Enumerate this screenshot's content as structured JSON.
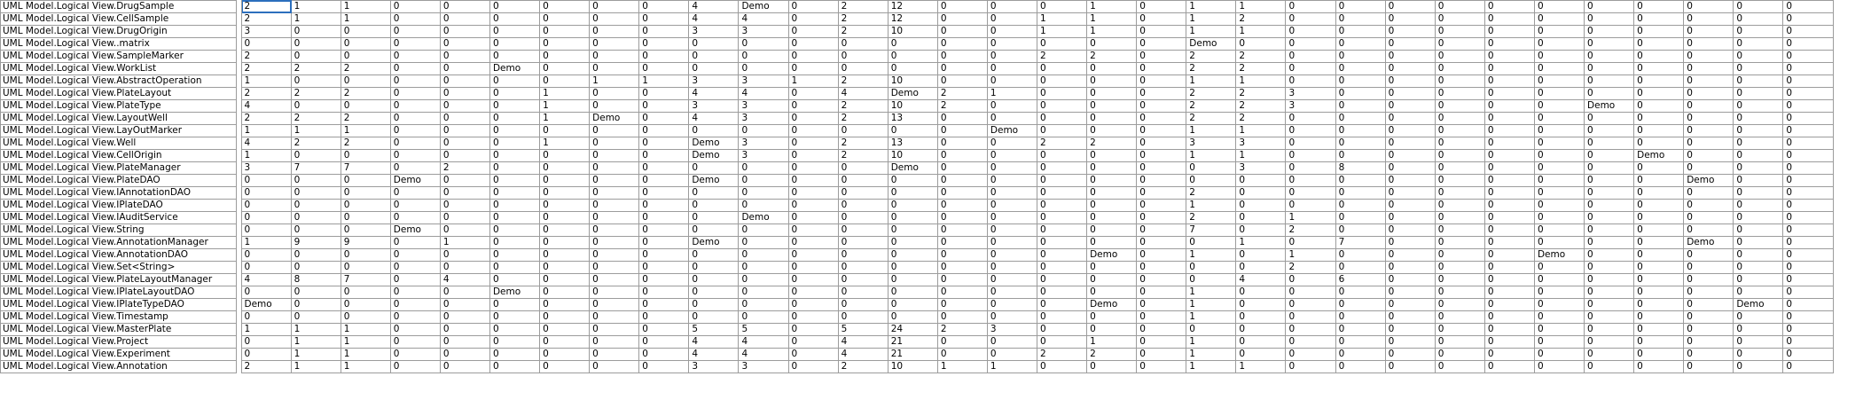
{
  "selection": {
    "row": 0,
    "accent": "#2c6fbd"
  },
  "rows": [
    {
      "name": "UML Model.Logical View.DrugSample",
      "values": [
        "2",
        "1",
        "1",
        "0",
        "0",
        "0",
        "0",
        "0",
        "0",
        "4",
        "Demo",
        "0",
        "2",
        "12",
        "0",
        "0",
        "0",
        "1",
        "0",
        "1",
        "1",
        "0",
        "0",
        "0",
        "0",
        "0",
        "0",
        "0",
        "0",
        "0",
        "0",
        "0"
      ]
    },
    {
      "name": "UML Model.Logical View.CellSample",
      "values": [
        "2",
        "1",
        "1",
        "0",
        "0",
        "0",
        "0",
        "0",
        "0",
        "4",
        "4",
        "0",
        "2",
        "12",
        "0",
        "0",
        "1",
        "1",
        "0",
        "1",
        "2",
        "0",
        "0",
        "0",
        "0",
        "0",
        "0",
        "0",
        "0",
        "0",
        "0",
        "0"
      ]
    },
    {
      "name": "UML Model.Logical View.DrugOrigin",
      "values": [
        "3",
        "0",
        "0",
        "0",
        "0",
        "0",
        "0",
        "0",
        "0",
        "3",
        "3",
        "0",
        "2",
        "10",
        "0",
        "0",
        "1",
        "1",
        "0",
        "1",
        "1",
        "0",
        "0",
        "0",
        "0",
        "0",
        "0",
        "0",
        "0",
        "0",
        "0",
        "0"
      ]
    },
    {
      "name": "UML Model.Logical View..matrix",
      "values": [
        "0",
        "0",
        "0",
        "0",
        "0",
        "0",
        "0",
        "0",
        "0",
        "0",
        "0",
        "0",
        "0",
        "0",
        "0",
        "0",
        "0",
        "0",
        "0",
        "Demo",
        "0",
        "0",
        "0",
        "0",
        "0",
        "0",
        "0",
        "0",
        "0",
        "0",
        "0",
        "0"
      ]
    },
    {
      "name": "UML Model.Logical View.SampleMarker",
      "values": [
        "2",
        "0",
        "0",
        "0",
        "0",
        "0",
        "0",
        "0",
        "0",
        "0",
        "0",
        "0",
        "0",
        "0",
        "0",
        "0",
        "2",
        "2",
        "0",
        "2",
        "2",
        "0",
        "0",
        "0",
        "0",
        "0",
        "0",
        "0",
        "0",
        "0",
        "0",
        "0"
      ]
    },
    {
      "name": "UML Model.Logical View.WorkList",
      "values": [
        "2",
        "2",
        "2",
        "0",
        "0",
        "Demo",
        "0",
        "0",
        "0",
        "0",
        "0",
        "0",
        "0",
        "0",
        "0",
        "0",
        "0",
        "0",
        "0",
        "2",
        "2",
        "0",
        "0",
        "0",
        "0",
        "0",
        "0",
        "0",
        "0",
        "0",
        "0",
        "0"
      ]
    },
    {
      "name": "UML Model.Logical View.AbstractOperation",
      "values": [
        "1",
        "0",
        "0",
        "0",
        "0",
        "0",
        "0",
        "1",
        "1",
        "3",
        "3",
        "1",
        "2",
        "10",
        "0",
        "0",
        "0",
        "0",
        "0",
        "1",
        "1",
        "0",
        "0",
        "0",
        "0",
        "0",
        "0",
        "0",
        "0",
        "0",
        "0",
        "0"
      ]
    },
    {
      "name": "UML Model.Logical View.PlateLayout",
      "values": [
        "2",
        "2",
        "2",
        "0",
        "0",
        "0",
        "1",
        "0",
        "0",
        "4",
        "4",
        "0",
        "4",
        "Demo",
        "2",
        "1",
        "0",
        "0",
        "0",
        "2",
        "2",
        "3",
        "0",
        "0",
        "0",
        "0",
        "0",
        "0",
        "0",
        "0",
        "0",
        "0"
      ]
    },
    {
      "name": "UML Model.Logical View.PlateType",
      "values": [
        "4",
        "0",
        "0",
        "0",
        "0",
        "0",
        "1",
        "0",
        "0",
        "3",
        "3",
        "0",
        "2",
        "10",
        "2",
        "0",
        "0",
        "0",
        "0",
        "2",
        "2",
        "3",
        "0",
        "0",
        "0",
        "0",
        "0",
        "Demo",
        "0",
        "0",
        "0",
        "0"
      ]
    },
    {
      "name": "UML Model.Logical View.LayoutWell",
      "values": [
        "2",
        "2",
        "2",
        "0",
        "0",
        "0",
        "1",
        "Demo",
        "0",
        "4",
        "3",
        "0",
        "2",
        "13",
        "0",
        "0",
        "0",
        "0",
        "0",
        "2",
        "2",
        "0",
        "0",
        "0",
        "0",
        "0",
        "0",
        "0",
        "0",
        "0",
        "0",
        "0"
      ]
    },
    {
      "name": "UML Model.Logical View.LayOutMarker",
      "values": [
        "1",
        "1",
        "1",
        "0",
        "0",
        "0",
        "0",
        "0",
        "0",
        "0",
        "0",
        "0",
        "0",
        "0",
        "0",
        "Demo",
        "0",
        "0",
        "0",
        "1",
        "1",
        "0",
        "0",
        "0",
        "0",
        "0",
        "0",
        "0",
        "0",
        "0",
        "0",
        "0"
      ]
    },
    {
      "name": "UML Model.Logical View.Well",
      "values": [
        "4",
        "2",
        "2",
        "0",
        "0",
        "0",
        "1",
        "0",
        "0",
        "Demo",
        "3",
        "0",
        "2",
        "13",
        "0",
        "0",
        "2",
        "2",
        "0",
        "3",
        "3",
        "0",
        "0",
        "0",
        "0",
        "0",
        "0",
        "0",
        "0",
        "0",
        "0",
        "0"
      ]
    },
    {
      "name": "UML Model.Logical View.CellOrigin",
      "values": [
        "1",
        "0",
        "0",
        "0",
        "0",
        "0",
        "0",
        "0",
        "0",
        "Demo",
        "3",
        "0",
        "2",
        "10",
        "0",
        "0",
        "0",
        "0",
        "0",
        "1",
        "1",
        "0",
        "0",
        "0",
        "0",
        "0",
        "0",
        "0",
        "Demo",
        "0",
        "0",
        "0"
      ]
    },
    {
      "name": "UML Model.Logical View.PlateManager",
      "values": [
        "3",
        "7",
        "7",
        "0",
        "2",
        "0",
        "0",
        "0",
        "0",
        "0",
        "0",
        "0",
        "0",
        "Demo",
        "0",
        "0",
        "0",
        "0",
        "0",
        "0",
        "3",
        "0",
        "8",
        "0",
        "0",
        "0",
        "0",
        "0",
        "0",
        "0",
        "0",
        "0"
      ]
    },
    {
      "name": "UML Model.Logical View.PlateDAO",
      "values": [
        "0",
        "0",
        "0",
        "Demo",
        "0",
        "0",
        "0",
        "0",
        "0",
        "Demo",
        "0",
        "0",
        "0",
        "0",
        "0",
        "0",
        "0",
        "0",
        "0",
        "0",
        "0",
        "0",
        "0",
        "0",
        "0",
        "0",
        "0",
        "0",
        "0",
        "Demo",
        "0",
        "0"
      ]
    },
    {
      "name": "UML Model.Logical View.IAnnotationDAO",
      "values": [
        "0",
        "0",
        "0",
        "0",
        "0",
        "0",
        "0",
        "0",
        "0",
        "0",
        "0",
        "0",
        "0",
        "0",
        "0",
        "0",
        "0",
        "0",
        "0",
        "2",
        "0",
        "0",
        "0",
        "0",
        "0",
        "0",
        "0",
        "0",
        "0",
        "0",
        "0",
        "0"
      ]
    },
    {
      "name": "UML Model.Logical View.IPlateDAO",
      "values": [
        "0",
        "0",
        "0",
        "0",
        "0",
        "0",
        "0",
        "0",
        "0",
        "0",
        "0",
        "0",
        "0",
        "0",
        "0",
        "0",
        "0",
        "0",
        "0",
        "1",
        "0",
        "0",
        "0",
        "0",
        "0",
        "0",
        "0",
        "0",
        "0",
        "0",
        "0",
        "0"
      ]
    },
    {
      "name": "UML Model.Logical View.IAuditService",
      "values": [
        "0",
        "0",
        "0",
        "0",
        "0",
        "0",
        "0",
        "0",
        "0",
        "0",
        "Demo",
        "0",
        "0",
        "0",
        "0",
        "0",
        "0",
        "0",
        "0",
        "2",
        "0",
        "1",
        "0",
        "0",
        "0",
        "0",
        "0",
        "0",
        "0",
        "0",
        "0",
        "0"
      ]
    },
    {
      "name": "UML Model.Logical View.String",
      "values": [
        "0",
        "0",
        "0",
        "Demo",
        "0",
        "0",
        "0",
        "0",
        "0",
        "0",
        "0",
        "0",
        "0",
        "0",
        "0",
        "0",
        "0",
        "0",
        "0",
        "7",
        "0",
        "2",
        "0",
        "0",
        "0",
        "0",
        "0",
        "0",
        "0",
        "0",
        "0",
        "0"
      ]
    },
    {
      "name": "UML Model.Logical View.AnnotationManager",
      "values": [
        "1",
        "9",
        "9",
        "0",
        "1",
        "0",
        "0",
        "0",
        "0",
        "Demo",
        "0",
        "0",
        "0",
        "0",
        "0",
        "0",
        "0",
        "0",
        "0",
        "0",
        "1",
        "0",
        "7",
        "0",
        "0",
        "0",
        "0",
        "0",
        "0",
        "Demo",
        "0",
        "0"
      ]
    },
    {
      "name": "UML Model.Logical View.AnnotationDAO",
      "values": [
        "0",
        "0",
        "0",
        "0",
        "0",
        "0",
        "0",
        "0",
        "0",
        "0",
        "0",
        "0",
        "0",
        "0",
        "0",
        "0",
        "0",
        "Demo",
        "0",
        "1",
        "0",
        "1",
        "0",
        "0",
        "0",
        "0",
        "Demo",
        "0",
        "0",
        "0",
        "0",
        "0"
      ]
    },
    {
      "name": "UML Model.Logical View.Set<String>",
      "values": [
        "0",
        "0",
        "0",
        "0",
        "0",
        "0",
        "0",
        "0",
        "0",
        "0",
        "0",
        "0",
        "0",
        "0",
        "0",
        "0",
        "0",
        "0",
        "0",
        "0",
        "0",
        "2",
        "0",
        "0",
        "0",
        "0",
        "0",
        "0",
        "0",
        "0",
        "0",
        "0"
      ]
    },
    {
      "name": "UML Model.Logical View.PlateLayoutManager",
      "values": [
        "4",
        "8",
        "7",
        "0",
        "4",
        "0",
        "0",
        "0",
        "0",
        "0",
        "0",
        "0",
        "0",
        "0",
        "0",
        "0",
        "0",
        "0",
        "0",
        "0",
        "4",
        "0",
        "6",
        "0",
        "0",
        "0",
        "0",
        "0",
        "0",
        "0",
        "0",
        "0"
      ]
    },
    {
      "name": "UML Model.Logical View.IPlateLayoutDAO",
      "values": [
        "0",
        "0",
        "0",
        "0",
        "0",
        "Demo",
        "0",
        "0",
        "0",
        "0",
        "0",
        "0",
        "0",
        "0",
        "0",
        "0",
        "0",
        "0",
        "0",
        "1",
        "0",
        "0",
        "0",
        "0",
        "0",
        "0",
        "0",
        "0",
        "0",
        "0",
        "0",
        "0"
      ]
    },
    {
      "name": "UML Model.Logical View.IPlateTypeDAO",
      "values": [
        "Demo",
        "0",
        "0",
        "0",
        "0",
        "0",
        "0",
        "0",
        "0",
        "0",
        "0",
        "0",
        "0",
        "0",
        "0",
        "0",
        "0",
        "Demo",
        "0",
        "1",
        "0",
        "0",
        "0",
        "0",
        "0",
        "0",
        "0",
        "0",
        "0",
        "0",
        "Demo",
        "0"
      ]
    },
    {
      "name": "UML Model.Logical View.Timestamp",
      "values": [
        "0",
        "0",
        "0",
        "0",
        "0",
        "0",
        "0",
        "0",
        "0",
        "0",
        "0",
        "0",
        "0",
        "0",
        "0",
        "0",
        "0",
        "0",
        "0",
        "1",
        "0",
        "0",
        "0",
        "0",
        "0",
        "0",
        "0",
        "0",
        "0",
        "0",
        "0",
        "0"
      ]
    },
    {
      "name": "UML Model.Logical View.MasterPlate",
      "values": [
        "1",
        "1",
        "1",
        "0",
        "0",
        "0",
        "0",
        "0",
        "0",
        "5",
        "5",
        "0",
        "5",
        "24",
        "2",
        "3",
        "0",
        "0",
        "0",
        "0",
        "0",
        "0",
        "0",
        "0",
        "0",
        "0",
        "0",
        "0",
        "0",
        "0",
        "0",
        "0"
      ]
    },
    {
      "name": "UML Model.Logical View.Project",
      "values": [
        "0",
        "1",
        "1",
        "0",
        "0",
        "0",
        "0",
        "0",
        "0",
        "4",
        "4",
        "0",
        "4",
        "21",
        "0",
        "0",
        "0",
        "1",
        "0",
        "1",
        "0",
        "0",
        "0",
        "0",
        "0",
        "0",
        "0",
        "0",
        "0",
        "0",
        "0",
        "0"
      ]
    },
    {
      "name": "UML Model.Logical View.Experiment",
      "values": [
        "0",
        "1",
        "1",
        "0",
        "0",
        "0",
        "0",
        "0",
        "0",
        "4",
        "4",
        "0",
        "4",
        "21",
        "0",
        "0",
        "2",
        "2",
        "0",
        "1",
        "0",
        "0",
        "0",
        "0",
        "0",
        "0",
        "0",
        "0",
        "0",
        "0",
        "0",
        "0"
      ]
    },
    {
      "name": "UML Model.Logical View.Annotation",
      "values": [
        "2",
        "1",
        "1",
        "0",
        "0",
        "0",
        "0",
        "0",
        "0",
        "3",
        "3",
        "0",
        "2",
        "10",
        "1",
        "1",
        "0",
        "0",
        "0",
        "1",
        "1",
        "0",
        "0",
        "0",
        "0",
        "0",
        "0",
        "0",
        "0",
        "0",
        "0",
        "0"
      ]
    }
  ]
}
